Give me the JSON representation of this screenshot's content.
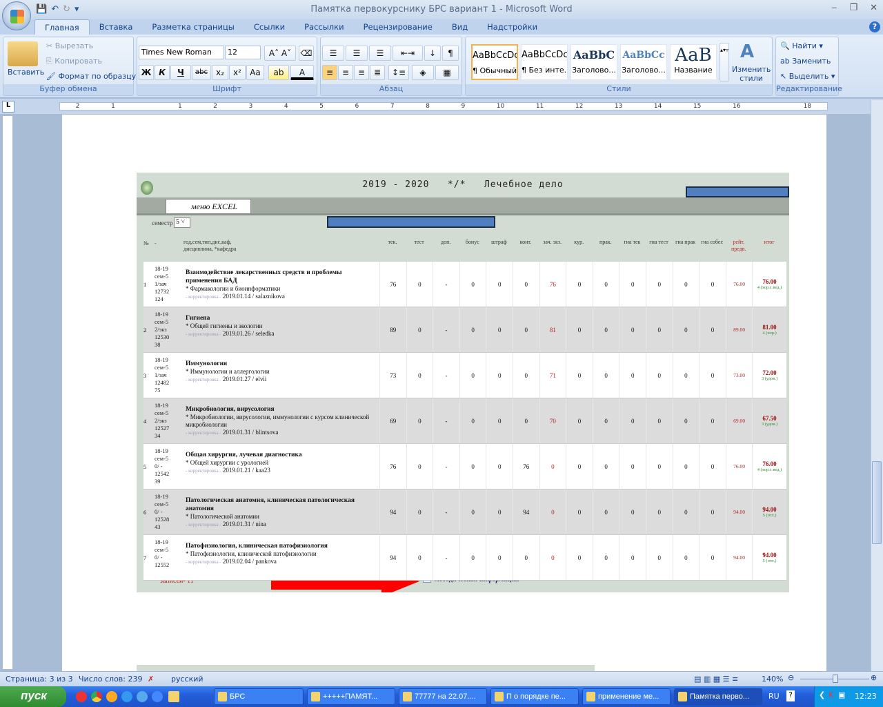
{
  "window": {
    "title": "Памятка первокурснику БРС вариант 1 - Microsoft Word",
    "minimize": "‒",
    "restore": "❐",
    "close": "✕",
    "qat": [
      "save-icon",
      "undo-icon",
      "redo-icon",
      "customize-icon"
    ]
  },
  "tabs": [
    "Главная",
    "Вставка",
    "Разметка страницы",
    "Ссылки",
    "Рассылки",
    "Рецензирование",
    "Вид",
    "Надстройки"
  ],
  "ribbon": {
    "clipboard": {
      "label": "Буфер обмена",
      "paste": "Вставить",
      "cut": "Вырезать",
      "copy": "Копировать",
      "format_painter": "Формат по образцу"
    },
    "font": {
      "label": "Шрифт",
      "font_name": "Times New Roman",
      "font_size": "12",
      "bold": "Ж",
      "italic": "К",
      "underline": "Ч",
      "strike": "abc",
      "sub": "x₂",
      "sup": "x²",
      "case": "Aa"
    },
    "paragraph": {
      "label": "Абзац"
    },
    "styles": {
      "label": "Стили",
      "items": [
        {
          "sample": "AaBbCcDc",
          "name": "¶ Обычный"
        },
        {
          "sample": "AaBbCcDc",
          "name": "¶ Без инте..."
        },
        {
          "sample": "AaBbC",
          "name": "Заголово..."
        },
        {
          "sample": "AaBbCc",
          "name": "Заголово..."
        },
        {
          "sample": "AaB",
          "name": "Название"
        }
      ],
      "change": "Изменить стили"
    },
    "editing": {
      "label": "Редактирование",
      "find": "Найти",
      "replace": "Заменить",
      "select": "Выделить"
    }
  },
  "ruler": [
    "2",
    "1",
    "",
    "1",
    "2",
    "3",
    "4",
    "5",
    "6",
    "7",
    "8",
    "9",
    "10",
    "11",
    "12",
    "13",
    "14",
    "15",
    "16",
    "",
    "18"
  ],
  "embedded": {
    "header": "2019 - 2020   */*   Лечебное дело",
    "menu_excel": "меню EXCEL",
    "semester_label": "семестр -",
    "semester_value": "5",
    "columns": {
      "num": "№",
      "dash": "-",
      "code": "год,сем,тип,дис,каф, дисциплина, *кафедра",
      "scores": [
        "тек.",
        "тест",
        "доп.",
        "бонус",
        "штраф",
        "конт.",
        "зач. экз.",
        "кур.",
        "прак.",
        "гиа тек",
        "гиа тест",
        "гиа прак",
        "гиа собес",
        "рейт. предв.",
        "итог"
      ]
    },
    "correction_label": "- корректировка -",
    "rows": [
      {
        "n": "1",
        "code": [
          "18-19",
          "сем-5",
          "1/зач",
          "12732",
          "124"
        ],
        "title": "Взаимодействие лекарственных средств и проблемы применения БАД",
        "dept": "* Фармакологии и биоинформатики",
        "date": "2019.01.14 / salaznikova",
        "scores": [
          "76",
          "0",
          "-",
          "0",
          "0",
          "0",
          "76",
          "0",
          "0",
          "0",
          "0",
          "0",
          "0",
          "76.00"
        ],
        "total": "76.00",
        "grade": "4 (хор.с вед.)"
      },
      {
        "n": "2",
        "code": [
          "18-19",
          "сем-5",
          "2/экз",
          "12530",
          "38"
        ],
        "title": "Гигиена",
        "dept": "* Общей гигиены и экологии",
        "date": "2019.01.26 / seledka",
        "scores": [
          "89",
          "0",
          "-",
          "0",
          "0",
          "0",
          "81",
          "0",
          "0",
          "0",
          "0",
          "0",
          "0",
          "89.00"
        ],
        "total": "81.00",
        "grade": "4 (хор.)"
      },
      {
        "n": "3",
        "code": [
          "18-19",
          "сем-5",
          "1/зач",
          "12482",
          "75"
        ],
        "title": "Иммунология",
        "dept": "* Иммунологии и аллергологии",
        "date": "2019.01.27 / elvii",
        "scores": [
          "73",
          "0",
          "-",
          "0",
          "0",
          "0",
          "71",
          "0",
          "0",
          "0",
          "0",
          "0",
          "0",
          "73.00"
        ],
        "total": "72.00",
        "grade": "3 (удов.)"
      },
      {
        "n": "4",
        "code": [
          "18-19",
          "сем-5",
          "2/экз",
          "12527",
          "34"
        ],
        "title": "Микробиология, вирусология",
        "dept": "* Микробиологии, вирусологии, иммунологии с курсом клинической микробиологии",
        "date": "2019.01.31 / blintsova",
        "scores": [
          "69",
          "0",
          "-",
          "0",
          "0",
          "0",
          "70",
          "0",
          "0",
          "0",
          "0",
          "0",
          "0",
          "69.00"
        ],
        "total": "67.50",
        "grade": "3 (удов.)"
      },
      {
        "n": "5",
        "code": [
          "18-19",
          "сем-5",
          "0/ -",
          "12542",
          "39"
        ],
        "title": "Общая хирургия, лучевая диагностика",
        "dept": "* Общей хирургии с урологией",
        "date": "2019.01.21 / kaa23",
        "scores": [
          "76",
          "0",
          "-",
          "0",
          "0",
          "76",
          "0",
          "0",
          "0",
          "0",
          "0",
          "0",
          "0",
          "76.00"
        ],
        "total": "76.00",
        "grade": "4 (хор.с вед.)"
      },
      {
        "n": "6",
        "code": [
          "18-19",
          "сем-5",
          "0/ -",
          "12528",
          "43"
        ],
        "title": "Патологическая анатомия, клиническая патологическая анатомия",
        "dept": "* Патологической анатомии",
        "date": "2019.01.31 / nina",
        "scores": [
          "94",
          "0",
          "-",
          "0",
          "0",
          "94",
          "0",
          "0",
          "0",
          "0",
          "0",
          "0",
          "0",
          "94.00"
        ],
        "total": "94.00",
        "grade": "5 (отл.)"
      },
      {
        "n": "7",
        "code": [
          "18-19",
          "сем-5",
          "0/ -",
          "12552",
          ""
        ],
        "title": "Патофизиология, клиническая патофизиология",
        "dept": "* Патофизиологии, клинической патофизиологии",
        "date": "2019.02.04 / pankova",
        "scores": [
          "94",
          "0",
          "-",
          "0",
          "0",
          "0",
          "0",
          "0",
          "0",
          "0",
          "0",
          "0",
          "0",
          "94.00"
        ],
        "total": "94.00",
        "grade": "5 (отл.)"
      }
    ],
    "records": "записей- 11",
    "method_info": "методическая информация"
  },
  "status": {
    "page": "Страница: 3 из 3",
    "words": "Число слов: 239",
    "lang": "русский",
    "zoom": "140%",
    "zoom_level_percent": 140
  },
  "taskbar": {
    "start": "пуск",
    "items": [
      "БРС",
      "+++++ПАМЯТ...",
      "77777 на 22.07....",
      "П о порядке пе...",
      "применение ме...",
      "Памятка перво..."
    ],
    "lang": "RU",
    "time": "12:23"
  },
  "colors": {
    "red_value": "#b22222",
    "grade_green": "#2a8a2a",
    "arrow": "#ff0000",
    "bluebar": "#4f7fbf"
  }
}
